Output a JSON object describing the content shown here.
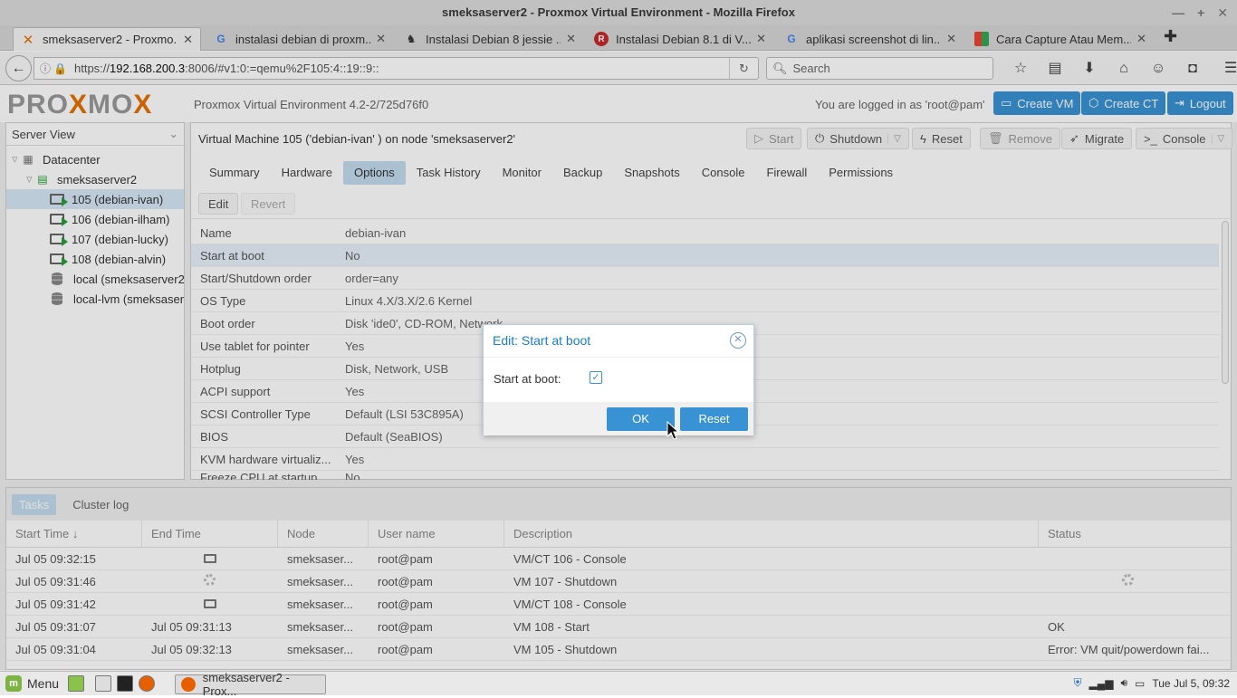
{
  "window": {
    "title": "smeksaserver2 - Proxmox Virtual Environment - Mozilla Firefox"
  },
  "tabs": [
    {
      "label": "smeksaserver2 - Proxmo...",
      "icon": "proxmox-icon",
      "active": true
    },
    {
      "label": "instalasi debian di proxm...",
      "icon": "google-icon"
    },
    {
      "label": "Instalasi Debian 8 jessie ...",
      "icon": "dog-icon"
    },
    {
      "label": "Instalasi Debian 8.1 di V...",
      "icon": "red-r-icon"
    },
    {
      "label": "aplikasi screenshot di lin...",
      "icon": "google-icon"
    },
    {
      "label": "Cara Capture Atau Mem...",
      "icon": "blogger-icon"
    }
  ],
  "url": {
    "prefix": "https://",
    "host": "192.168.200.3",
    "rest": ":8006/#v1:0:=qemu%2F105:4::19::9::"
  },
  "search": {
    "placeholder": "Search"
  },
  "header": {
    "logo_a": "PRO",
    "logo_x": "X",
    "logo_b": "MO",
    "logo_x2": "X",
    "version": "Proxmox Virtual Environment 4.2-2/725d76f0",
    "logged_in": "You are logged in as 'root@pam'",
    "create_vm": "Create VM",
    "create_ct": "Create CT",
    "logout": "Logout"
  },
  "sidebar": {
    "view": "Server View",
    "datacenter": "Datacenter",
    "node": "smeksaserver2",
    "vms": [
      "105 (debian-ivan)",
      "106 (debian-ilham)",
      "107 (debian-lucky)",
      "108 (debian-alvin)"
    ],
    "storages": [
      "local (smeksaserver2",
      "local-lvm (smeksaser"
    ]
  },
  "main": {
    "title": "Virtual Machine 105 ('debian-ivan' ) on node 'smeksaserver2'",
    "buttons": {
      "start": "Start",
      "shutdown": "Shutdown",
      "reset": "Reset",
      "remove": "Remove",
      "migrate": "Migrate",
      "console": "Console"
    },
    "tabs": [
      "Summary",
      "Hardware",
      "Options",
      "Task History",
      "Monitor",
      "Backup",
      "Snapshots",
      "Console",
      "Firewall",
      "Permissions"
    ],
    "edit": "Edit",
    "revert": "Revert",
    "options": [
      {
        "k": "Name",
        "v": "debian-ivan"
      },
      {
        "k": "Start at boot",
        "v": "No"
      },
      {
        "k": "Start/Shutdown order",
        "v": "order=any"
      },
      {
        "k": "OS Type",
        "v": "Linux 4.X/3.X/2.6 Kernel"
      },
      {
        "k": "Boot order",
        "v": "Disk 'ide0', CD-ROM, Network"
      },
      {
        "k": "Use tablet for pointer",
        "v": "Yes"
      },
      {
        "k": "Hotplug",
        "v": "Disk, Network, USB"
      },
      {
        "k": "ACPI support",
        "v": "Yes"
      },
      {
        "k": "SCSI Controller Type",
        "v": "Default (LSI 53C895A)"
      },
      {
        "k": "BIOS",
        "v": "Default (SeaBIOS)"
      },
      {
        "k": "KVM hardware virtualiz...",
        "v": "Yes"
      },
      {
        "k": "Freeze CPU at startup",
        "v": "No"
      }
    ]
  },
  "bottom": {
    "tab_tasks": "Tasks",
    "tab_cluster": "Cluster log",
    "columns": [
      "Start Time ↓",
      "End Time",
      "Node",
      "User name",
      "Description",
      "Status"
    ],
    "rows": [
      {
        "start": "Jul 05 09:32:15",
        "end": "",
        "end_icon": "monitor",
        "node": "smeksaser...",
        "user": "root@pam",
        "desc": "VM/CT 106 - Console",
        "status": "",
        "status_icon": ""
      },
      {
        "start": "Jul 05 09:31:46",
        "end": "",
        "end_icon": "spinner",
        "node": "smeksaser...",
        "user": "root@pam",
        "desc": "VM 107 - Shutdown",
        "status": "",
        "status_icon": "spinner"
      },
      {
        "start": "Jul 05 09:31:42",
        "end": "",
        "end_icon": "monitor",
        "node": "smeksaser...",
        "user": "root@pam",
        "desc": "VM/CT 108 - Console",
        "status": "",
        "status_icon": ""
      },
      {
        "start": "Jul 05 09:31:07",
        "end": "Jul 05 09:31:13",
        "end_icon": "",
        "node": "smeksaser...",
        "user": "root@pam",
        "desc": "VM 108 - Start",
        "status": "OK",
        "status_icon": ""
      },
      {
        "start": "Jul 05 09:31:04",
        "end": "Jul 05 09:32:13",
        "end_icon": "",
        "node": "smeksaser...",
        "user": "root@pam",
        "desc": "VM 105 - Shutdown",
        "status": "Error: VM quit/powerdown fai...",
        "status_icon": ""
      }
    ]
  },
  "dialog": {
    "title": "Edit: Start at boot",
    "label": "Start at boot:",
    "checked": true,
    "ok": "OK",
    "reset": "Reset"
  },
  "taskbar": {
    "menu": "Menu",
    "task": "smeksaserver2 - Prox...",
    "clock": "Tue Jul  5, 09:32"
  },
  "colors": {
    "accent": "#3892d4",
    "logo_x": "#e57000",
    "selected": "#c3dcf0"
  }
}
